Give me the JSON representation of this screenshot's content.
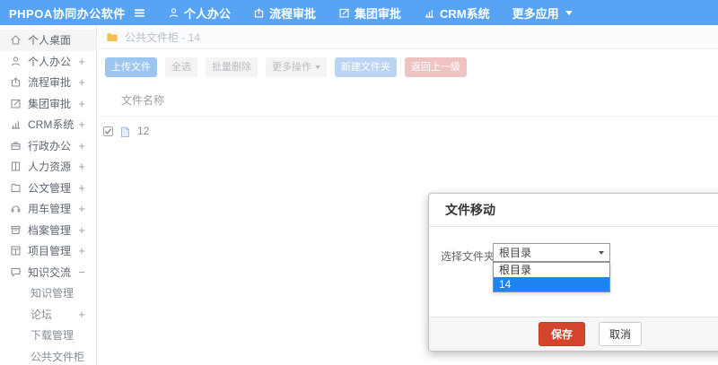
{
  "topbar": {
    "logo": "PHPOA协同办公软件",
    "nav": [
      {
        "label": "个人办公",
        "icon": "user-icon"
      },
      {
        "label": "流程审批",
        "icon": "process-icon"
      },
      {
        "label": "集团审批",
        "icon": "edit-icon"
      },
      {
        "label": "CRM系统",
        "icon": "chart-icon"
      },
      {
        "label": "更多应用",
        "icon": "caret-down-icon"
      }
    ]
  },
  "sidebar": {
    "items": [
      {
        "label": "个人桌面",
        "icon": "home-icon",
        "expand": ""
      },
      {
        "label": "个人办公",
        "icon": "user-icon",
        "expand": "+"
      },
      {
        "label": "流程审批",
        "icon": "process-icon",
        "expand": "+"
      },
      {
        "label": "集团审批",
        "icon": "edit-icon",
        "expand": "+"
      },
      {
        "label": "CRM系统",
        "icon": "chart-icon",
        "expand": "+"
      },
      {
        "label": "行政办公",
        "icon": "briefcase-icon",
        "expand": "+"
      },
      {
        "label": "人力资源",
        "icon": "book-icon",
        "expand": "+"
      },
      {
        "label": "公文管理",
        "icon": "document-icon",
        "expand": "+"
      },
      {
        "label": "用车管理",
        "icon": "headset-icon",
        "expand": "+"
      },
      {
        "label": "档案管理",
        "icon": "archive-icon",
        "expand": "+"
      },
      {
        "label": "项目管理",
        "icon": "project-icon",
        "expand": "+"
      },
      {
        "label": "知识交流",
        "icon": "chat-icon",
        "expand": "−",
        "children": [
          {
            "label": "知识管理",
            "expand": ""
          },
          {
            "label": "论坛",
            "expand": "+"
          },
          {
            "label": "下载管理",
            "expand": ""
          },
          {
            "label": "公共文件柜",
            "expand": ""
          }
        ]
      }
    ]
  },
  "breadcrumb": {
    "icon": "folder-icon",
    "text": "公共文件柜 - 14"
  },
  "toolbar": {
    "upload": "上传文件",
    "select_all": "全选",
    "batch_delete": "批量删除",
    "more_actions": "更多操作",
    "new_folder": "新建文件夹",
    "back": "返回上一级"
  },
  "table": {
    "name_header": "文件名称",
    "rows": [
      {
        "name": "12",
        "checked": true,
        "icon": "file-icon"
      }
    ]
  },
  "modal": {
    "title": "文件移动",
    "field_label": "选择文件夹",
    "select_value": "根目录",
    "options": [
      {
        "label": "根目录",
        "selected": false
      },
      {
        "label": "14",
        "selected": true
      }
    ],
    "save_label": "保存",
    "cancel_label": "取消"
  },
  "colors": {
    "topbar_blue": "#57a4f4",
    "upload_button_blue": "#9cc5ef",
    "new_folder_blue": "#b9d5f3",
    "back_button_pink": "#f0c3c3",
    "save_button_red": "#d5442c",
    "dropdown_highlight_blue": "#1f83f1",
    "folder_icon_yellow": "#f2c04d"
  }
}
